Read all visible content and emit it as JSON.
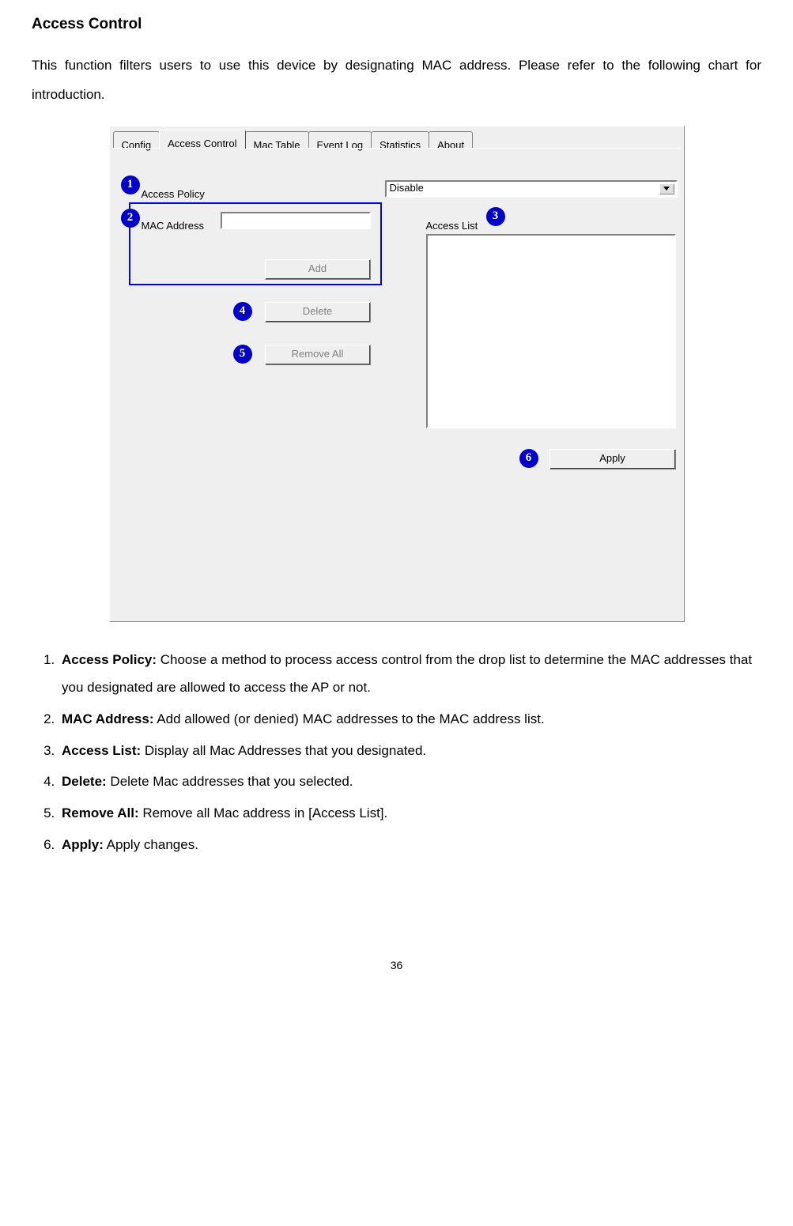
{
  "heading": "Access Control",
  "intro": "This function filters users to use this device by designating MAC address. Please refer to the following chart for introduction.",
  "tabs": {
    "config": "Config",
    "access_control": "Access Control",
    "mac_table": "Mac Table",
    "event_log": "Event Log",
    "statistics": "Statistics",
    "about": "About"
  },
  "panel": {
    "access_policy_label": "Access Policy",
    "access_policy_value": "Disable",
    "mac_address_label": "MAC Address",
    "access_list_label": "Access List",
    "add_btn": "Add",
    "delete_btn": "Delete",
    "remove_all_btn": "Remove All",
    "apply_btn": "Apply"
  },
  "callouts": {
    "c1": "1",
    "c2": "2",
    "c3": "3",
    "c4": "4",
    "c5": "5",
    "c6": "6"
  },
  "notes": [
    {
      "bold": "Access Policy:",
      "text": " Choose a method to process access control from the drop list to determine the MAC addresses that you designated are allowed to access the AP or not."
    },
    {
      "bold": "MAC Address:",
      "text": " Add allowed (or denied) MAC addresses to the MAC address list."
    },
    {
      "bold": "Access List:",
      "text": " Display all Mac Addresses that you designated."
    },
    {
      "bold": "Delete:",
      "text": " Delete Mac addresses that you selected."
    },
    {
      "bold": "Remove All:",
      "text": " Remove all Mac address in [Access List]."
    },
    {
      "bold": "Apply:",
      "text": " Apply changes."
    }
  ],
  "page_number": "36"
}
